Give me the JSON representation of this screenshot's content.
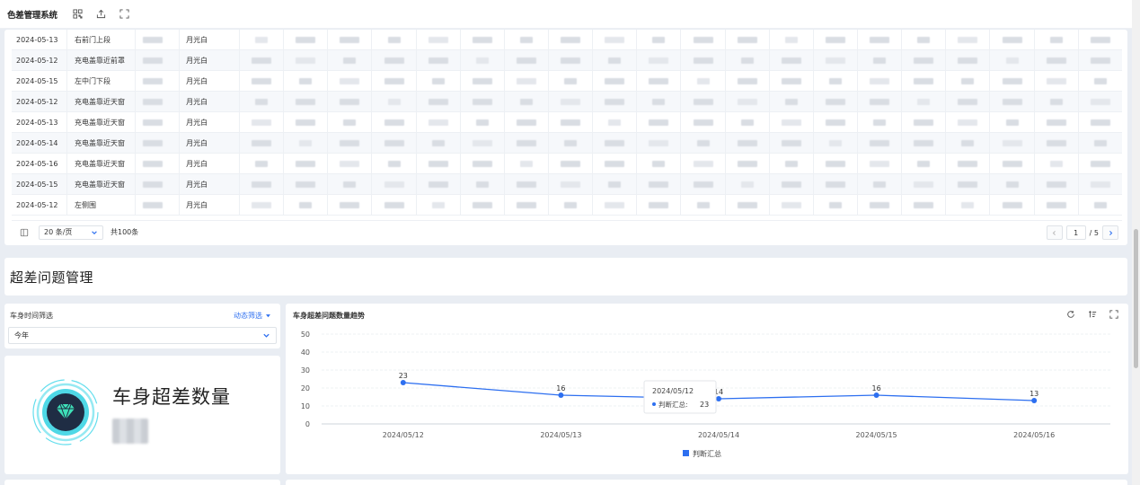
{
  "app": {
    "title": "色差管理系统"
  },
  "table": {
    "rows": [
      {
        "date": "2024-05-13",
        "part": "右前门上段",
        "color": "月光白"
      },
      {
        "date": "2024-05-12",
        "part": "充电盖靠近前罩",
        "color": "月光白"
      },
      {
        "date": "2024-05-15",
        "part": "左中门下段",
        "color": "月光白"
      },
      {
        "date": "2024-05-12",
        "part": "充电盖靠近天窗",
        "color": "月光白"
      },
      {
        "date": "2024-05-13",
        "part": "充电盖靠近天窗",
        "color": "月光白"
      },
      {
        "date": "2024-05-14",
        "part": "充电盖靠近天窗",
        "color": "月光白"
      },
      {
        "date": "2024-05-16",
        "part": "充电盖靠近天窗",
        "color": "月光白"
      },
      {
        "date": "2024-05-15",
        "part": "充电盖靠近天窗",
        "color": "月光白"
      },
      {
        "date": "2024-05-12",
        "part": "左侧围",
        "color": "月光白"
      }
    ],
    "pagination": {
      "page_size": "20 条/页",
      "total": "共100条",
      "current": "1",
      "of_pages": "/ 5"
    }
  },
  "section": {
    "title": "超差问题管理"
  },
  "filter": {
    "label": "车身时间筛选",
    "dynamic": "动态筛选",
    "selected": "今年"
  },
  "kpi": {
    "title": "车身超差数量"
  },
  "chart": {
    "title": "车身超差问题数量趋势",
    "tooltip": {
      "date": "2024/05/12",
      "series": "判断汇总:",
      "value": "23"
    }
  },
  "chart_data": {
    "type": "line",
    "x": [
      "2024/05/12",
      "2024/05/13",
      "2024/05/14",
      "2024/05/15",
      "2024/05/16"
    ],
    "series": [
      {
        "name": "判断汇总",
        "values": [
          23,
          16,
          14,
          16,
          13
        ],
        "color": "#2d6ff0"
      }
    ],
    "ylim": [
      0,
      50
    ],
    "yticks": [
      0,
      10,
      20,
      30,
      40,
      50
    ],
    "grid": true,
    "legend": "bottom-center"
  }
}
